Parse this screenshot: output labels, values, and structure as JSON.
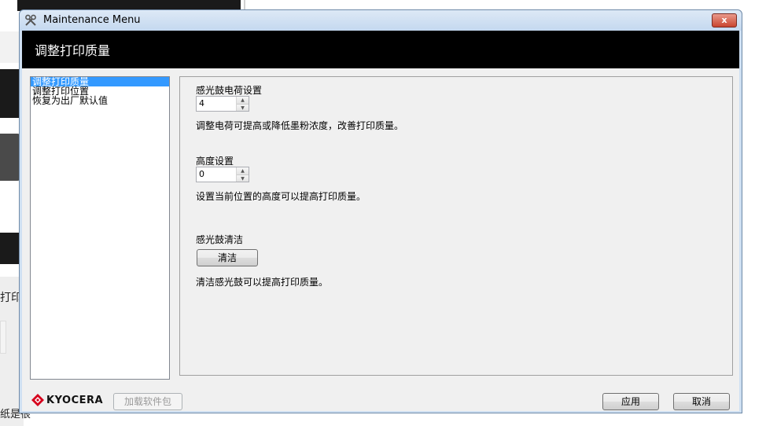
{
  "background": {
    "text_fragment_1": "打印",
    "text_fragment_2": "纸是很"
  },
  "window": {
    "title": "Maintenance Menu",
    "close_symbol": "x"
  },
  "header": {
    "title": "调整打印质量"
  },
  "nav": {
    "items": [
      {
        "label": "调整打印质量",
        "selected": true
      },
      {
        "label": "调整打印位置",
        "selected": false
      },
      {
        "label": "恢复为出厂默认值",
        "selected": false
      }
    ]
  },
  "content": {
    "charge": {
      "label": "感光鼓电荷设置",
      "value": "4",
      "description": "调整电荷可提高或降低墨粉浓度，改善打印质量。"
    },
    "altitude": {
      "label": "高度设置",
      "value": "0",
      "description": "设置当前位置的高度可以提高打印质量。"
    },
    "drum_clean": {
      "label": "感光鼓清洁",
      "button_label": "清洁",
      "description": "清洁感光鼓可以提高打印质量。"
    }
  },
  "footer": {
    "logo_text": "KYOCERA",
    "download_button_label": "加载软件包",
    "apply_button_label": "应用",
    "cancel_button_label": "取消"
  },
  "colors": {
    "selection": "#3399ff",
    "header_bg": "#000000",
    "brand_red": "#d6001c"
  },
  "icons": {
    "title_icon": "tools-icon",
    "spin_up": "arrow-up-icon",
    "spin_down": "arrow-down-icon"
  }
}
